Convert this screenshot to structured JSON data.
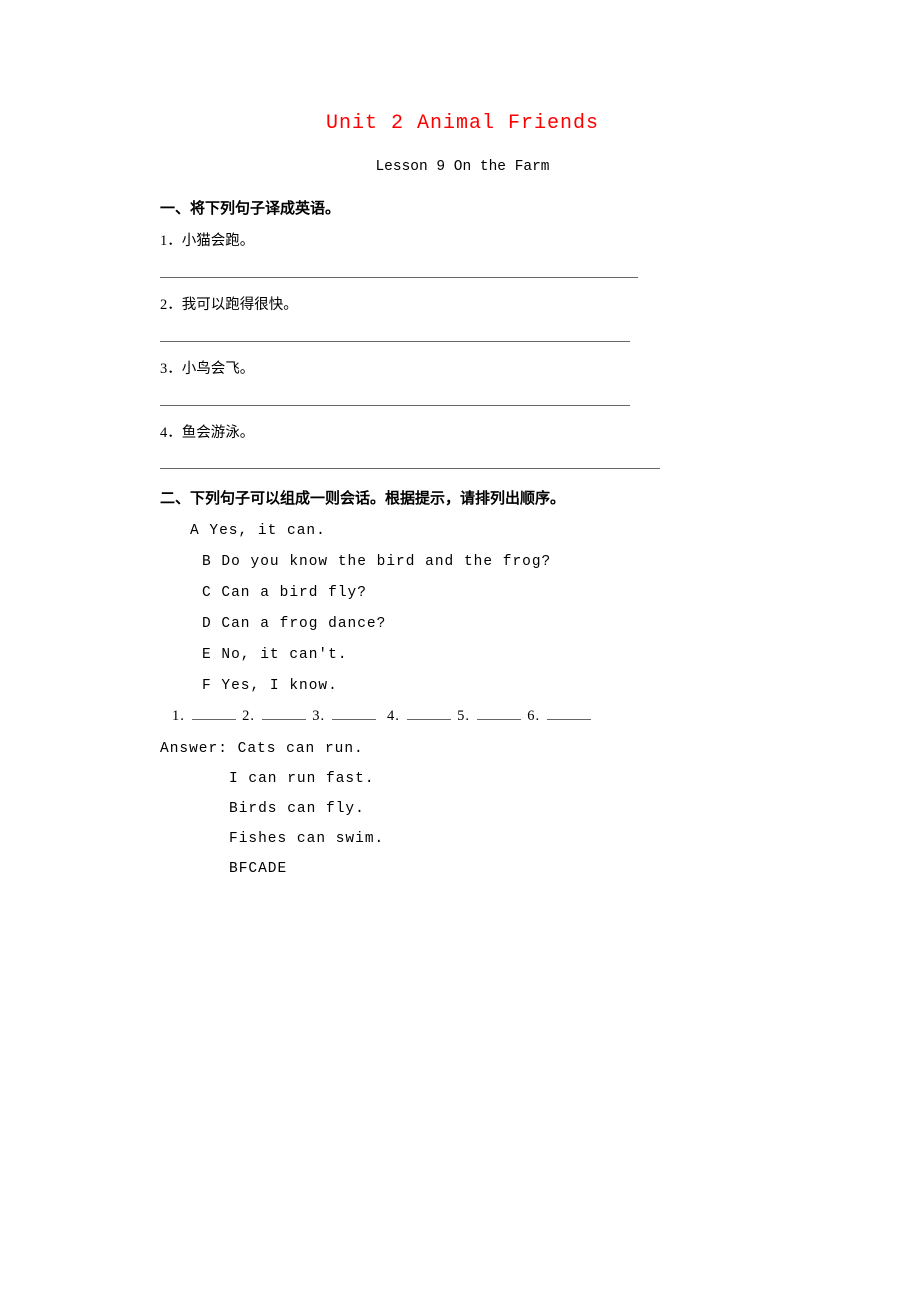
{
  "title": "Unit 2 Animal Friends",
  "subtitle": "Lesson 9 On the Farm",
  "section1": {
    "heading": "一、将下列句子译成英语。",
    "items": [
      "1．小猫会跑。",
      "2．我可以跑得很快。",
      "3．小鸟会飞。",
      "4．鱼会游泳。"
    ]
  },
  "section2": {
    "heading": "二、下列句子可以组成一则会话。根据提示，请排列出顺序。",
    "options": [
      "A Yes, it can.",
      "B Do you know the bird and the frog?",
      "C Can a bird fly?",
      "D Can a frog dance?",
      "E No, it can't.",
      "F Yes, I know."
    ],
    "sequence_labels": [
      "1.",
      "2.",
      "3.",
      "4.",
      "5.",
      "6."
    ]
  },
  "answer": {
    "label": "Answer: ",
    "lines": [
      "Cats can run.",
      "I can run fast.",
      "Birds can fly.",
      "Fishes can swim.",
      "BFCADE"
    ]
  }
}
